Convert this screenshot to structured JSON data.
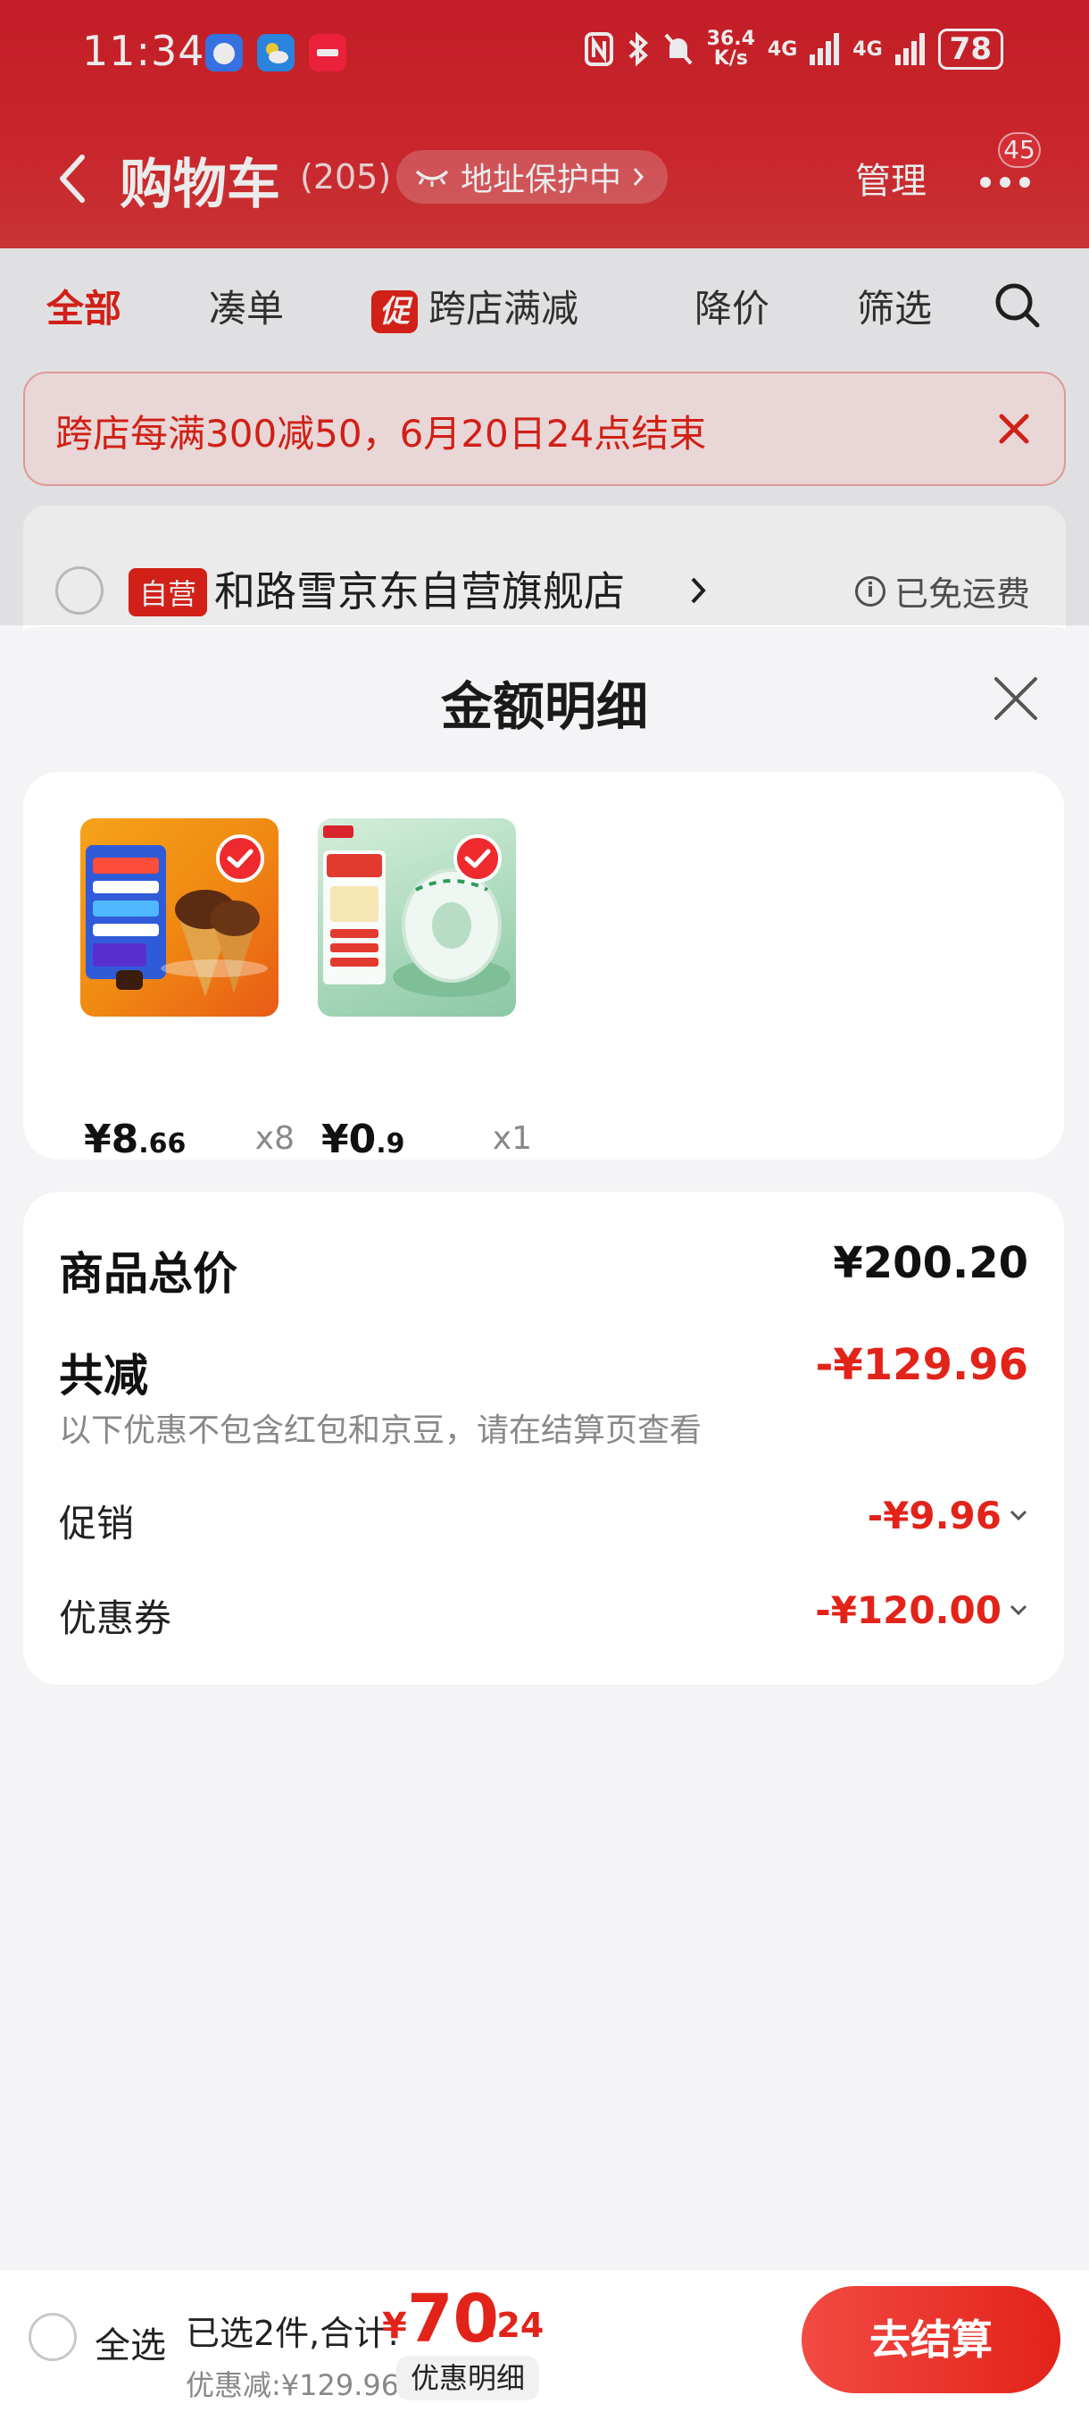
{
  "status_bar": {
    "time": "11:34",
    "net_speed_top": "36.4",
    "net_speed_bottom": "K/s",
    "signal1": "4G",
    "signal2": "4G",
    "battery": "78"
  },
  "header": {
    "title": "购物车",
    "count": "(205)",
    "address_protect": "地址保护中",
    "manage": "管理",
    "more_badge": "45"
  },
  "tabs": [
    {
      "label": "全部"
    },
    {
      "label": "凑单"
    },
    {
      "label": "跨店满减",
      "mark": "促"
    },
    {
      "label": "降价"
    },
    {
      "label": "筛选"
    }
  ],
  "notice": {
    "text": "跨店每满300减50，6月20日24点结束"
  },
  "store": {
    "tag": "自营",
    "name": "和路雪京东自营旗舰店",
    "shipping": "已免运费"
  },
  "sheet": {
    "title": "金额明细",
    "items": [
      {
        "price_int": "¥8",
        "price_dec": ".66",
        "qty": "x8"
      },
      {
        "price_int": "¥0",
        "price_dec": ".9",
        "qty": "x1"
      }
    ],
    "summary": {
      "goods_total_label": "商品总价",
      "goods_total_value": "¥200.20",
      "reduction_label": "共减",
      "reduction_value": "-¥129.96",
      "reduction_note": "以下优惠不包含红包和京豆，请在结算页查看",
      "promo_label": "促销",
      "promo_value": "-¥9.96",
      "coupon_label": "优惠券",
      "coupon_value": "-¥120.00"
    }
  },
  "checkout": {
    "select_all": "全选",
    "selected_text": "已选2件,合计:",
    "total_yen": "¥",
    "total_int": "70",
    "total_dec": ".24",
    "discount_text": "优惠减:¥129.96",
    "detail_label": "优惠明细",
    "button_label": "去结算"
  },
  "colors": {
    "brand_red": "#e2231a",
    "header_red": "#d4202b"
  }
}
